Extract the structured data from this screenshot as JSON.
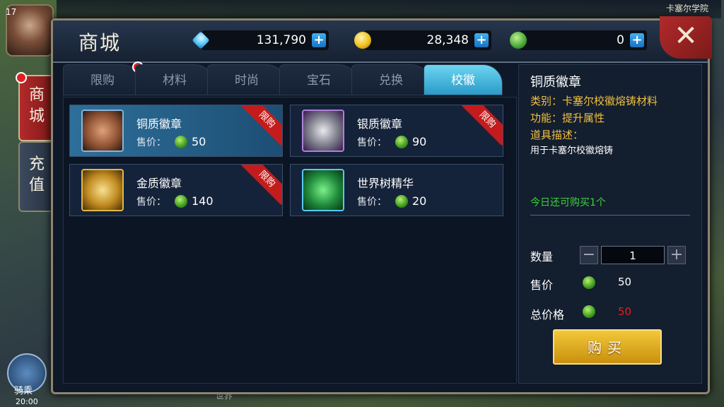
{
  "hud": {
    "level": "17",
    "zone": "卡塞尔学院",
    "mount_label": "骑乘",
    "clock": "20:00",
    "chat_channel": "世界"
  },
  "side_tabs": [
    {
      "label": "商城"
    },
    {
      "label": "充值"
    }
  ],
  "shop": {
    "title": "商城",
    "currencies": [
      {
        "icon": "diamond-icon",
        "value": "131,790",
        "color": "#58c8f8"
      },
      {
        "icon": "gold-coin-icon",
        "value": "28,348",
        "color": "#f0c020"
      },
      {
        "icon": "green-coin-icon",
        "value": "0",
        "color": "#4cae3c"
      }
    ],
    "close_label": "✕",
    "tabs": [
      {
        "label": "限购",
        "has_dot": true
      },
      {
        "label": "材料"
      },
      {
        "label": "时尚"
      },
      {
        "label": "宝石"
      },
      {
        "label": "兑换"
      },
      {
        "label": "校徽",
        "active": true
      }
    ],
    "items": [
      {
        "name": "铜质徽章",
        "price_label": "售价：",
        "price": "50",
        "limited": "限购",
        "icon": "bronze-badge-icon",
        "selected": true
      },
      {
        "name": "银质徽章",
        "price_label": "售价：",
        "price": "90",
        "limited": "限购",
        "icon": "silver-badge-icon"
      },
      {
        "name": "金质徽章",
        "price_label": "售价：",
        "price": "140",
        "limited": "限购",
        "icon": "gold-badge-icon"
      },
      {
        "name": "世界树精华",
        "price_label": "售价：",
        "price": "20",
        "icon": "world-tree-essence-icon"
      }
    ],
    "detail": {
      "title": "铜质徽章",
      "category": "类别：卡塞尔校徽熔铸材料",
      "function": "功能：提升属性",
      "desc_label": "道具描述：",
      "desc": "用于卡塞尔校徽熔铸",
      "limit_text": "今日还可购买1个",
      "qty_label": "数量",
      "qty_value": "1",
      "minus": "−",
      "plus": "+",
      "price_label": "售价",
      "price_value": "50",
      "total_label": "总价格",
      "total_value": "50",
      "total_color": "#e02020",
      "buy_label": "购买"
    }
  }
}
